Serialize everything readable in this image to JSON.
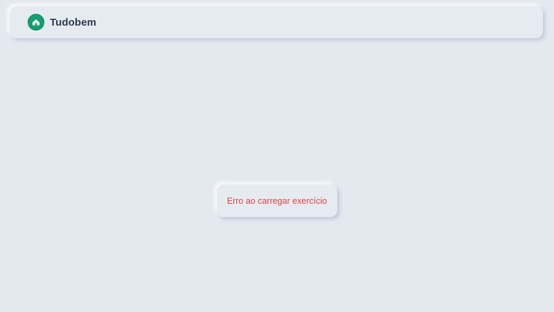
{
  "app": {
    "brand_name": "Tudobem",
    "logo_icon": "home-icon"
  },
  "main": {
    "error_message": "Erro ao carregar exercício"
  },
  "colors": {
    "background": "#e4e9f0",
    "accent": "#14a06f",
    "error": "#e0443c",
    "text": "#2f3a4d"
  }
}
